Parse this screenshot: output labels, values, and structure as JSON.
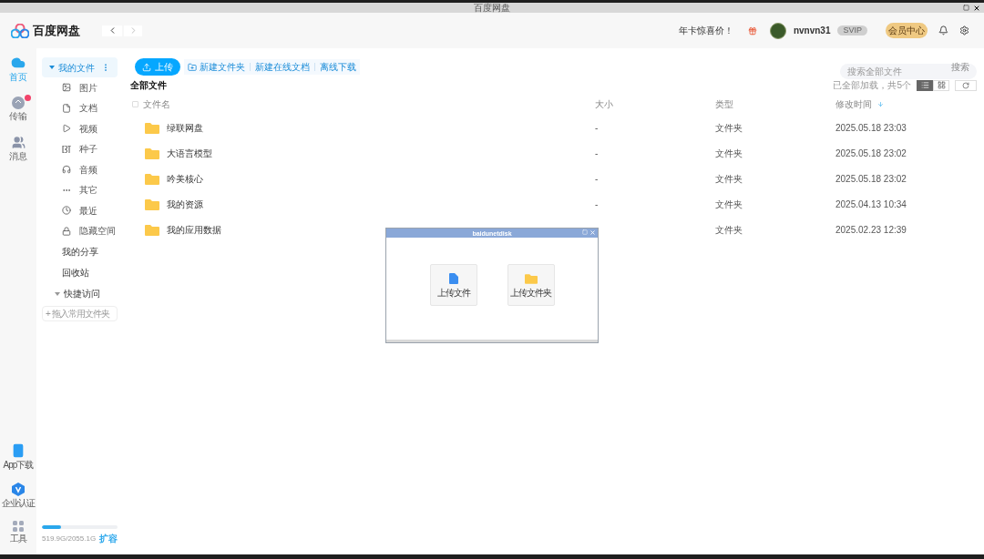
{
  "window": {
    "title": "百度网盘"
  },
  "header": {
    "logo": "百度网盘",
    "promo": "年卡惊喜价！",
    "username": "nvnvn31",
    "level_badge": "SVIP",
    "vip_button": "会员中心"
  },
  "rail": {
    "top": [
      {
        "label": "首页",
        "kind": "home",
        "selected": true,
        "badge": false
      },
      {
        "label": "传输",
        "kind": "transfer",
        "selected": false,
        "badge": true
      },
      {
        "label": "消息",
        "kind": "message",
        "selected": false,
        "badge": false
      }
    ],
    "bottom": [
      {
        "label": "App下载",
        "kind": "phone"
      },
      {
        "label": "企业认证",
        "kind": "verify"
      },
      {
        "label": "工具",
        "kind": "tools"
      }
    ]
  },
  "sidebar": {
    "my_files": {
      "label": "我的文件",
      "expanded": true,
      "selected": true,
      "children": [
        {
          "label": "图片",
          "kind": "image"
        },
        {
          "label": "文档",
          "kind": "doc"
        },
        {
          "label": "视频",
          "kind": "video"
        },
        {
          "label": "种子",
          "kind": "bt"
        },
        {
          "label": "音频",
          "kind": "audio"
        },
        {
          "label": "其它",
          "kind": "other"
        },
        {
          "label": "最近",
          "kind": "recent"
        },
        {
          "label": "隐藏空间",
          "kind": "lock"
        }
      ]
    },
    "links": [
      "我的分享",
      "回收站"
    ],
    "quick_access": {
      "label": "快捷访问",
      "expanded": true,
      "add": "+ 拖入常用文件夹"
    },
    "storage": {
      "text": "519.9G/2055.1G",
      "level": 0.25,
      "action": "扩容"
    }
  },
  "toolbar": {
    "upload": "上传",
    "actions": [
      "新建文件夹",
      "新建在线文档",
      "离线下载"
    ],
    "search": {
      "placeholder": "搜索全部文件",
      "button": "搜索"
    }
  },
  "breadcrumb": "全部文件",
  "load_status": "已全部加载，共5个",
  "views": [
    {
      "kind": "list",
      "selected": true
    },
    {
      "kind": "grid",
      "selected": false
    }
  ],
  "table": {
    "all_checked": false,
    "columns": [
      "文件名",
      "大小",
      "类型",
      "修改时间"
    ],
    "rows": [
      {
        "name": "绿联网盘",
        "size": "-",
        "type": "文件夹",
        "modified": "2025.05.18 23:03"
      },
      {
        "name": "大语言模型",
        "size": "-",
        "type": "文件夹",
        "modified": "2025.05.18 23:02"
      },
      {
        "name": "吟美核心",
        "size": "-",
        "type": "文件夹",
        "modified": "2025.05.18 23:02"
      },
      {
        "name": "我的资源",
        "size": "-",
        "type": "文件夹",
        "modified": "2025.04.13 10:34"
      },
      {
        "name": "我的应用数据",
        "type": "文件夹",
        "modified": "2025.02.23 12:39"
      }
    ]
  },
  "dialog": {
    "title": "baidunetdisk",
    "buttons": [
      {
        "label": "上传文件",
        "kind": "file"
      },
      {
        "label": "上传文件夹",
        "kind": "folder"
      }
    ]
  }
}
